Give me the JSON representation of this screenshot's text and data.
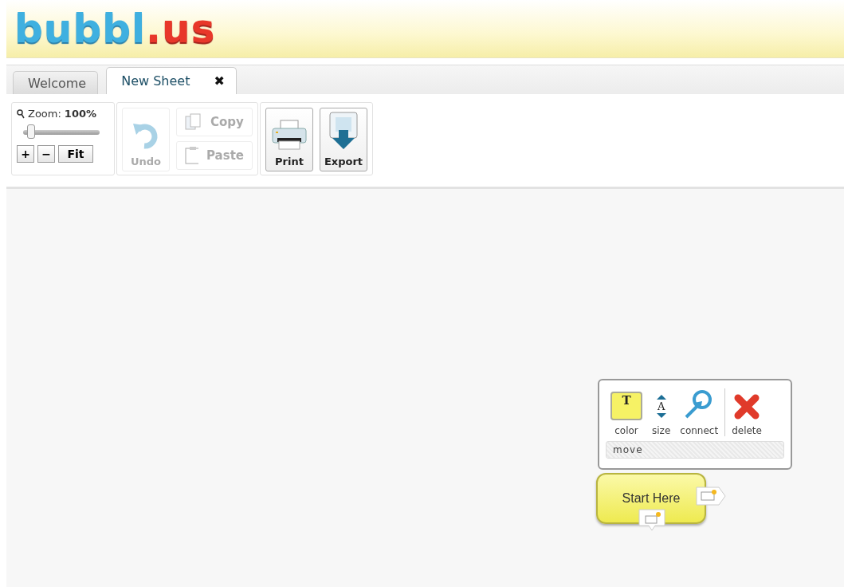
{
  "logo": {
    "main": "bubbl",
    "suffix": ".us"
  },
  "tabs": [
    {
      "label": "Welcome",
      "selected": false,
      "closable": false
    },
    {
      "label": "New Sheet",
      "selected": true,
      "closable": true,
      "close": "✖"
    }
  ],
  "zoom": {
    "label": "Zoom:",
    "value": "100%",
    "level": 0.1,
    "plus": "+",
    "minus": "−",
    "fit": "Fit"
  },
  "edit_buttons": [
    {
      "kind": "undo",
      "label": "Undo",
      "disabled": true
    },
    {
      "kind": "copy",
      "label": "Copy",
      "disabled": true
    },
    {
      "kind": "paste",
      "label": "Paste",
      "disabled": true
    }
  ],
  "file_buttons": [
    {
      "kind": "print",
      "label": "Print"
    },
    {
      "kind": "export",
      "label": "Export"
    }
  ],
  "bubble_menu": {
    "tools": [
      {
        "kind": "color",
        "label": "color",
        "color": "#f6f265",
        "glyph": "T"
      },
      {
        "kind": "size",
        "label": "size",
        "glyph": "A"
      },
      {
        "kind": "connect",
        "label": "connect"
      },
      {
        "kind": "delete",
        "label": "delete"
      }
    ],
    "move": "move"
  },
  "bubble": {
    "text": "Start Here",
    "color": "#eeea50"
  }
}
